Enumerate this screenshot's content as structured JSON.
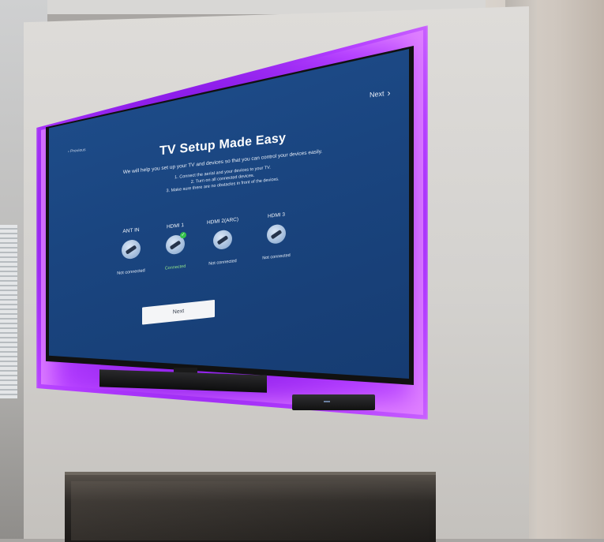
{
  "screen": {
    "previous_label": "Previous",
    "next_link_label": "Next",
    "title": "TV Setup Made Easy",
    "subtitle": "We will help you set up your TV and devices so that you can control your devices easily.",
    "steps": [
      "1. Connect the aerial and your devices to your TV.",
      "2. Turn on all connected devices.",
      "3. Make sure there are no obstacles in front of the devices."
    ],
    "ports": [
      {
        "label": "ANT IN",
        "status": "Not connected",
        "connected": false
      },
      {
        "label": "HDMI 1",
        "status": "Connected",
        "connected": true
      },
      {
        "label": "HDMI 2(ARC)",
        "status": "Not connected",
        "connected": false
      },
      {
        "label": "HDMI 3",
        "status": "Not connected",
        "connected": false
      }
    ],
    "next_button_label": "Next"
  },
  "colors": {
    "screen_blue": "#1a4580",
    "ambient_purple": "#8a1be8",
    "connected_green": "#34c24a"
  }
}
